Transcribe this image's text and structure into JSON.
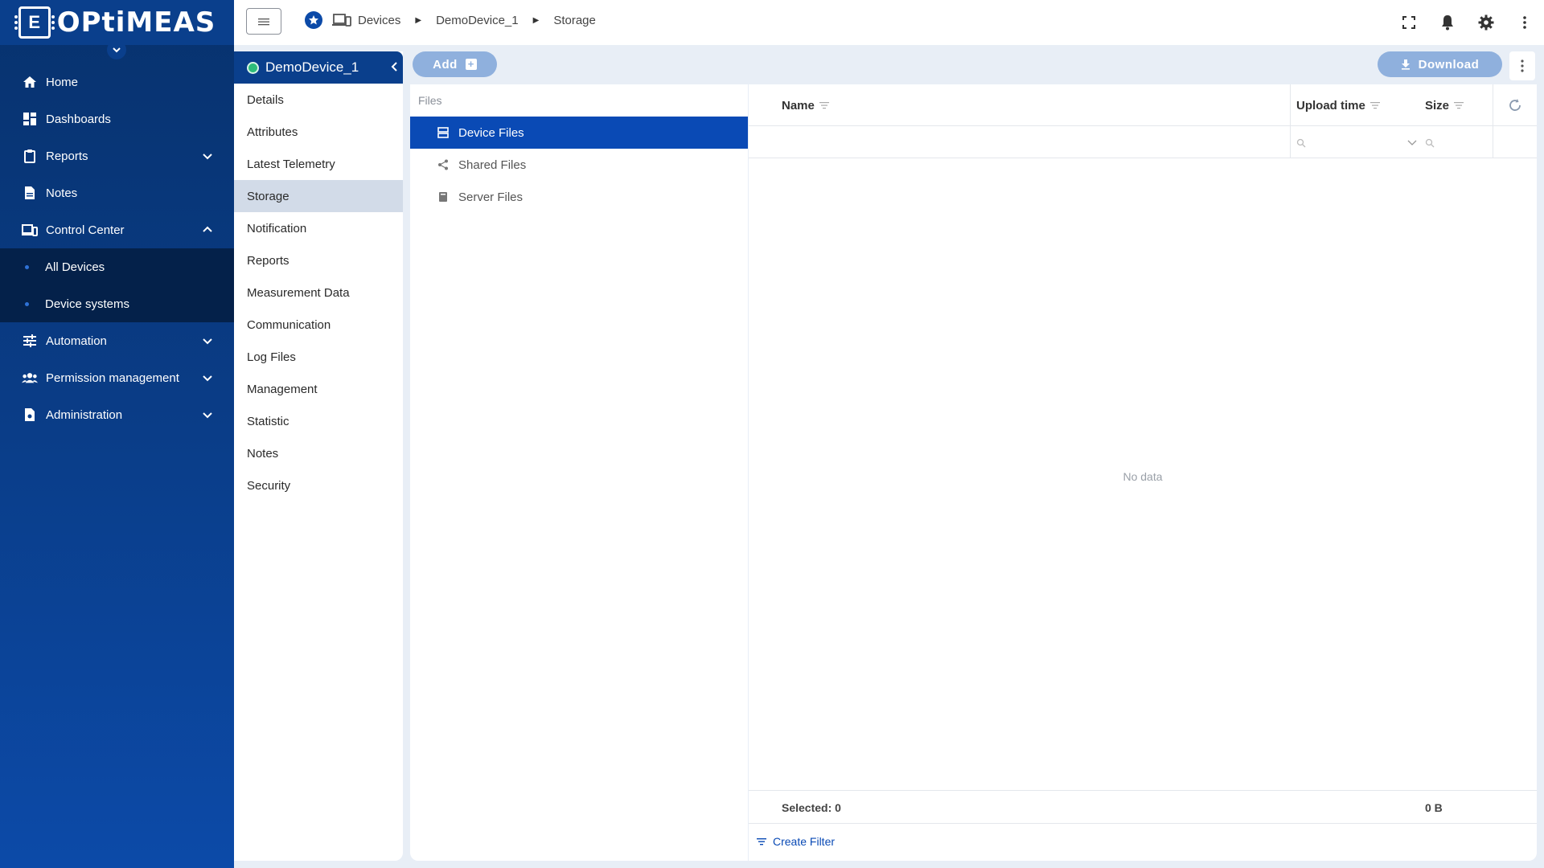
{
  "app": {
    "logo_text": "OPtiMEAS",
    "logo_chip_letter": "E"
  },
  "sidebar": {
    "items": [
      {
        "label": "Home",
        "icon": "home-icon"
      },
      {
        "label": "Dashboards",
        "icon": "dashboard-icon"
      },
      {
        "label": "Reports",
        "icon": "clipboard-icon",
        "expandable": true
      },
      {
        "label": "Notes",
        "icon": "note-icon"
      },
      {
        "label": "Control Center",
        "icon": "devices-icon",
        "expanded": true
      },
      {
        "label": "Automation",
        "icon": "tune-icon",
        "expandable": true
      },
      {
        "label": "Permission management",
        "icon": "people-icon",
        "expandable": true
      },
      {
        "label": "Administration",
        "icon": "admin-doc-icon",
        "expandable": true
      }
    ],
    "control_center_children": [
      "All Devices",
      "Device systems"
    ]
  },
  "breadcrumb": {
    "items": [
      "Devices",
      "DemoDevice_1",
      "Storage"
    ]
  },
  "device": {
    "name": "DemoDevice_1",
    "status_color": "#2dbd7a",
    "menu": [
      "Details",
      "Attributes",
      "Latest Telemetry",
      "Storage",
      "Notification",
      "Reports",
      "Measurement Data",
      "Communication",
      "Log Files",
      "Management",
      "Statistic",
      "Notes",
      "Security"
    ],
    "active_menu": "Storage"
  },
  "actions": {
    "add_label": "Add",
    "download_label": "Download"
  },
  "files": {
    "label": "Files",
    "items": [
      "Device Files",
      "Shared Files",
      "Server Files"
    ],
    "active": "Device Files"
  },
  "table": {
    "columns": [
      "Name",
      "Upload time",
      "Size"
    ],
    "empty_text": "No data",
    "footer_selected": "Selected: 0",
    "footer_size": "0 B",
    "create_filter_label": "Create Filter"
  },
  "colors": {
    "primary": "#0a4ab5",
    "sidebar": "#0a3f8c",
    "button_disabled": "#8fb0dd"
  }
}
